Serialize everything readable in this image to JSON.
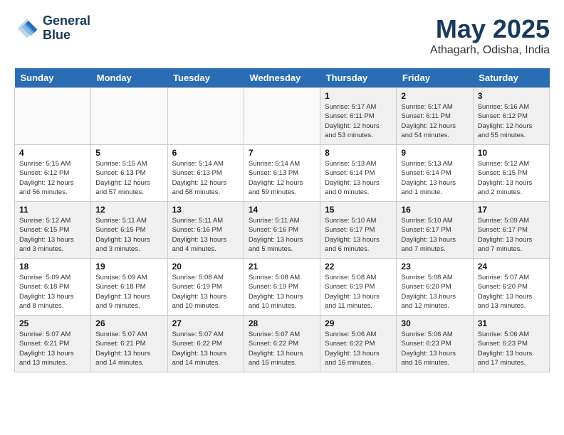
{
  "header": {
    "logo_line1": "General",
    "logo_line2": "Blue",
    "month": "May 2025",
    "location": "Athagarh, Odisha, India"
  },
  "weekdays": [
    "Sunday",
    "Monday",
    "Tuesday",
    "Wednesday",
    "Thursday",
    "Friday",
    "Saturday"
  ],
  "weeks": [
    [
      {
        "day": "",
        "info": ""
      },
      {
        "day": "",
        "info": ""
      },
      {
        "day": "",
        "info": ""
      },
      {
        "day": "",
        "info": ""
      },
      {
        "day": "1",
        "info": "Sunrise: 5:17 AM\nSunset: 6:11 PM\nDaylight: 12 hours\nand 53 minutes."
      },
      {
        "day": "2",
        "info": "Sunrise: 5:17 AM\nSunset: 6:11 PM\nDaylight: 12 hours\nand 54 minutes."
      },
      {
        "day": "3",
        "info": "Sunrise: 5:16 AM\nSunset: 6:12 PM\nDaylight: 12 hours\nand 55 minutes."
      }
    ],
    [
      {
        "day": "4",
        "info": "Sunrise: 5:15 AM\nSunset: 6:12 PM\nDaylight: 12 hours\nand 56 minutes."
      },
      {
        "day": "5",
        "info": "Sunrise: 5:15 AM\nSunset: 6:13 PM\nDaylight: 12 hours\nand 57 minutes."
      },
      {
        "day": "6",
        "info": "Sunrise: 5:14 AM\nSunset: 6:13 PM\nDaylight: 12 hours\nand 58 minutes."
      },
      {
        "day": "7",
        "info": "Sunrise: 5:14 AM\nSunset: 6:13 PM\nDaylight: 12 hours\nand 59 minutes."
      },
      {
        "day": "8",
        "info": "Sunrise: 5:13 AM\nSunset: 6:14 PM\nDaylight: 13 hours\nand 0 minutes."
      },
      {
        "day": "9",
        "info": "Sunrise: 5:13 AM\nSunset: 6:14 PM\nDaylight: 13 hours\nand 1 minute."
      },
      {
        "day": "10",
        "info": "Sunrise: 5:12 AM\nSunset: 6:15 PM\nDaylight: 13 hours\nand 2 minutes."
      }
    ],
    [
      {
        "day": "11",
        "info": "Sunrise: 5:12 AM\nSunset: 6:15 PM\nDaylight: 13 hours\nand 3 minutes."
      },
      {
        "day": "12",
        "info": "Sunrise: 5:11 AM\nSunset: 6:15 PM\nDaylight: 13 hours\nand 3 minutes."
      },
      {
        "day": "13",
        "info": "Sunrise: 5:11 AM\nSunset: 6:16 PM\nDaylight: 13 hours\nand 4 minutes."
      },
      {
        "day": "14",
        "info": "Sunrise: 5:11 AM\nSunset: 6:16 PM\nDaylight: 13 hours\nand 5 minutes."
      },
      {
        "day": "15",
        "info": "Sunrise: 5:10 AM\nSunset: 6:17 PM\nDaylight: 13 hours\nand 6 minutes."
      },
      {
        "day": "16",
        "info": "Sunrise: 5:10 AM\nSunset: 6:17 PM\nDaylight: 13 hours\nand 7 minutes."
      },
      {
        "day": "17",
        "info": "Sunrise: 5:09 AM\nSunset: 6:17 PM\nDaylight: 13 hours\nand 7 minutes."
      }
    ],
    [
      {
        "day": "18",
        "info": "Sunrise: 5:09 AM\nSunset: 6:18 PM\nDaylight: 13 hours\nand 8 minutes."
      },
      {
        "day": "19",
        "info": "Sunrise: 5:09 AM\nSunset: 6:18 PM\nDaylight: 13 hours\nand 9 minutes."
      },
      {
        "day": "20",
        "info": "Sunrise: 5:08 AM\nSunset: 6:19 PM\nDaylight: 13 hours\nand 10 minutes."
      },
      {
        "day": "21",
        "info": "Sunrise: 5:08 AM\nSunset: 6:19 PM\nDaylight: 13 hours\nand 10 minutes."
      },
      {
        "day": "22",
        "info": "Sunrise: 5:08 AM\nSunset: 6:19 PM\nDaylight: 13 hours\nand 11 minutes."
      },
      {
        "day": "23",
        "info": "Sunrise: 5:08 AM\nSunset: 6:20 PM\nDaylight: 13 hours\nand 12 minutes."
      },
      {
        "day": "24",
        "info": "Sunrise: 5:07 AM\nSunset: 6:20 PM\nDaylight: 13 hours\nand 13 minutes."
      }
    ],
    [
      {
        "day": "25",
        "info": "Sunrise: 5:07 AM\nSunset: 6:21 PM\nDaylight: 13 hours\nand 13 minutes."
      },
      {
        "day": "26",
        "info": "Sunrise: 5:07 AM\nSunset: 6:21 PM\nDaylight: 13 hours\nand 14 minutes."
      },
      {
        "day": "27",
        "info": "Sunrise: 5:07 AM\nSunset: 6:22 PM\nDaylight: 13 hours\nand 14 minutes."
      },
      {
        "day": "28",
        "info": "Sunrise: 5:07 AM\nSunset: 6:22 PM\nDaylight: 13 hours\nand 15 minutes."
      },
      {
        "day": "29",
        "info": "Sunrise: 5:06 AM\nSunset: 6:22 PM\nDaylight: 13 hours\nand 16 minutes."
      },
      {
        "day": "30",
        "info": "Sunrise: 5:06 AM\nSunset: 6:23 PM\nDaylight: 13 hours\nand 16 minutes."
      },
      {
        "day": "31",
        "info": "Sunrise: 5:06 AM\nSunset: 6:23 PM\nDaylight: 13 hours\nand 17 minutes."
      }
    ]
  ]
}
